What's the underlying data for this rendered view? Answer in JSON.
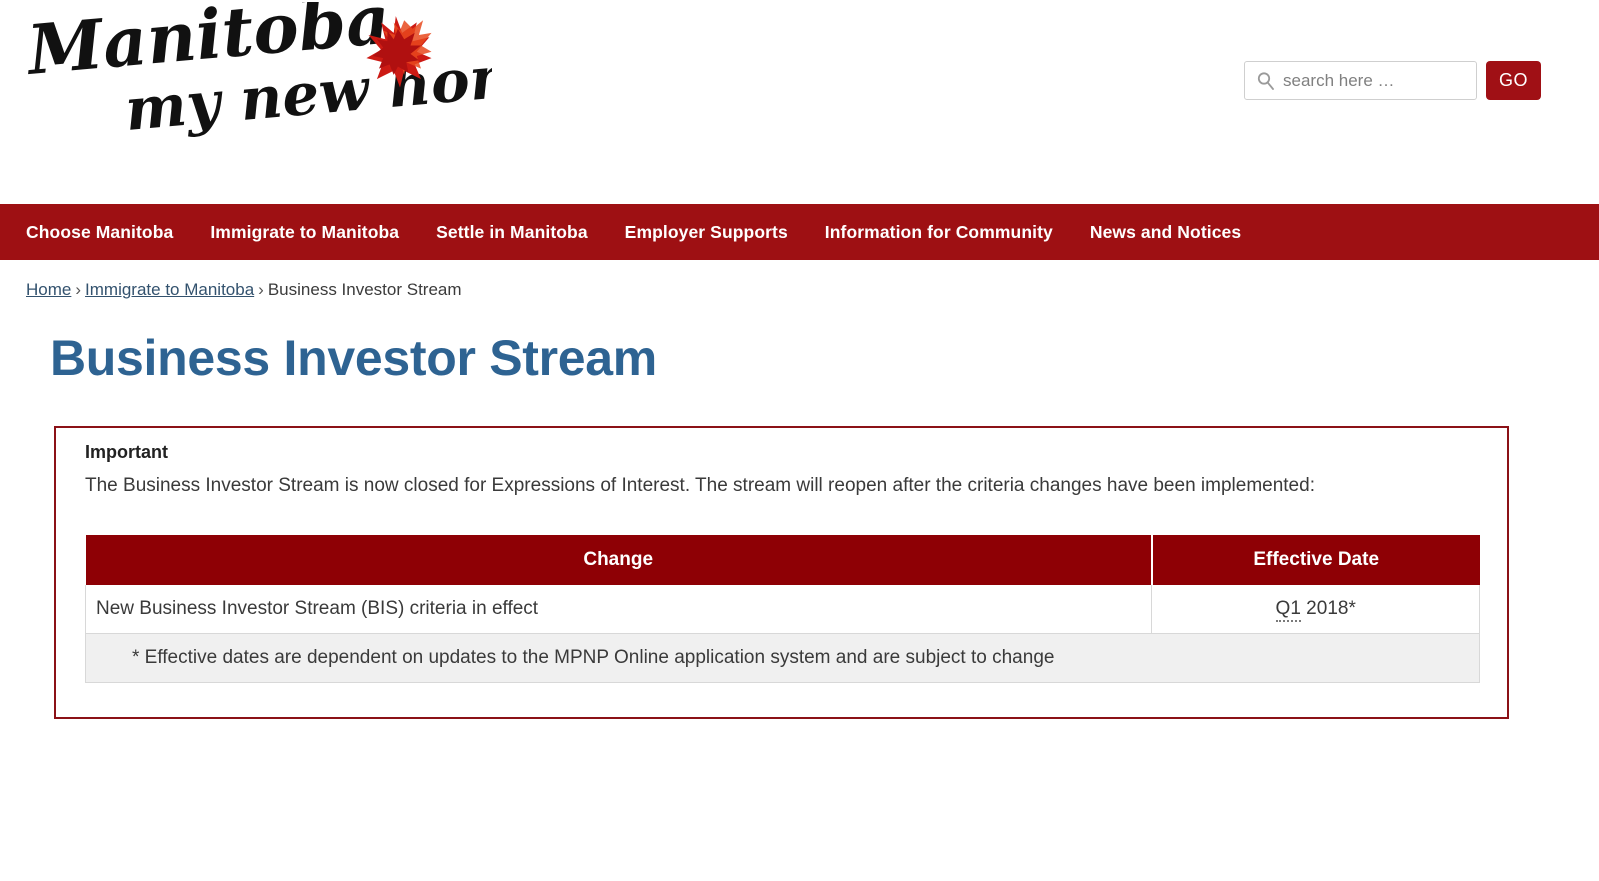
{
  "site": {
    "logo_line1": "Manitoba",
    "logo_line2": "my new home",
    "logo_icon": "maple-leaf-icon"
  },
  "search": {
    "icon": "search-icon",
    "placeholder": "search here …",
    "value": "",
    "button_label": "GO"
  },
  "nav": {
    "items": [
      {
        "label": "Choose Manitoba"
      },
      {
        "label": "Immigrate to Manitoba"
      },
      {
        "label": "Settle in Manitoba"
      },
      {
        "label": "Employer Supports"
      },
      {
        "label": "Information for Community"
      },
      {
        "label": "News and Notices"
      }
    ]
  },
  "breadcrumb": {
    "separator": "›",
    "items": [
      {
        "label": "Home",
        "link": true
      },
      {
        "label": "Immigrate to Manitoba",
        "link": true
      },
      {
        "label": "Business Investor Stream",
        "link": false
      }
    ]
  },
  "page": {
    "title": "Business Investor Stream"
  },
  "important": {
    "heading": "Important",
    "body": "The Business Investor Stream is now closed for Expressions of Interest. The stream will reopen after the criteria changes have been implemented:",
    "table": {
      "headers": [
        "Change",
        "Effective Date"
      ],
      "rows": [
        {
          "change": "New Business Investor Stream (BIS) criteria in effect",
          "date_marked": "Q1",
          "date_rest": " 2018*"
        }
      ],
      "footnote": "* Effective dates are dependent on updates to the MPNP Online application system and are subject to change"
    }
  },
  "colors": {
    "nav_red": "#9e1013",
    "button_red": "#a01015",
    "table_header_red": "#8e0005",
    "box_border_red": "#8b1117",
    "title_blue": "#2e6392",
    "footnote_bg": "#f0f0f0"
  }
}
